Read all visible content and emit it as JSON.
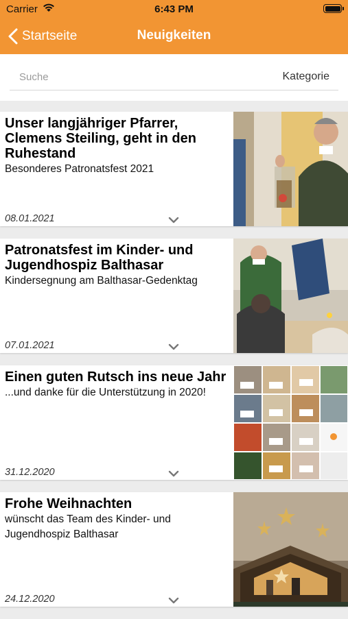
{
  "status": {
    "carrier": "Carrier",
    "time": "6:43 PM"
  },
  "nav": {
    "back_label": "Startseite",
    "title": "Neuigkeiten"
  },
  "search": {
    "placeholder": "Suche",
    "category_label": "Kategorie"
  },
  "news": [
    {
      "title": "Unser langjähriger Pfarrer, Clemens Steiling, geht in den Ruhestand",
      "subtitle": "Besonderes Patronatsfest 2021",
      "date": "08.01.2021"
    },
    {
      "title": "Patronatsfest im Kinder- und Jugendhospiz Balthasar",
      "subtitle": "Kindersegnung am Balthasar-Gedenktag",
      "date": "07.01.2021"
    },
    {
      "title": "Einen guten Rutsch ins neue Jahr",
      "subtitle": "...und danke für die Unterstützung in 2020!",
      "date": "31.12.2020"
    },
    {
      "title": "Frohe Weihnachten",
      "subtitle": "wünscht das Team des Kinder- und Jugendhospiz Balthasar",
      "date": "24.12.2020"
    }
  ],
  "colors": {
    "accent": "#f29533",
    "card_bg": "#ffffff",
    "page_bg": "#ececec"
  },
  "icons": {
    "back": "chevron-left-icon",
    "expand": "chevron-down-icon",
    "wifi": "wifi-icon",
    "battery": "battery-icon"
  }
}
